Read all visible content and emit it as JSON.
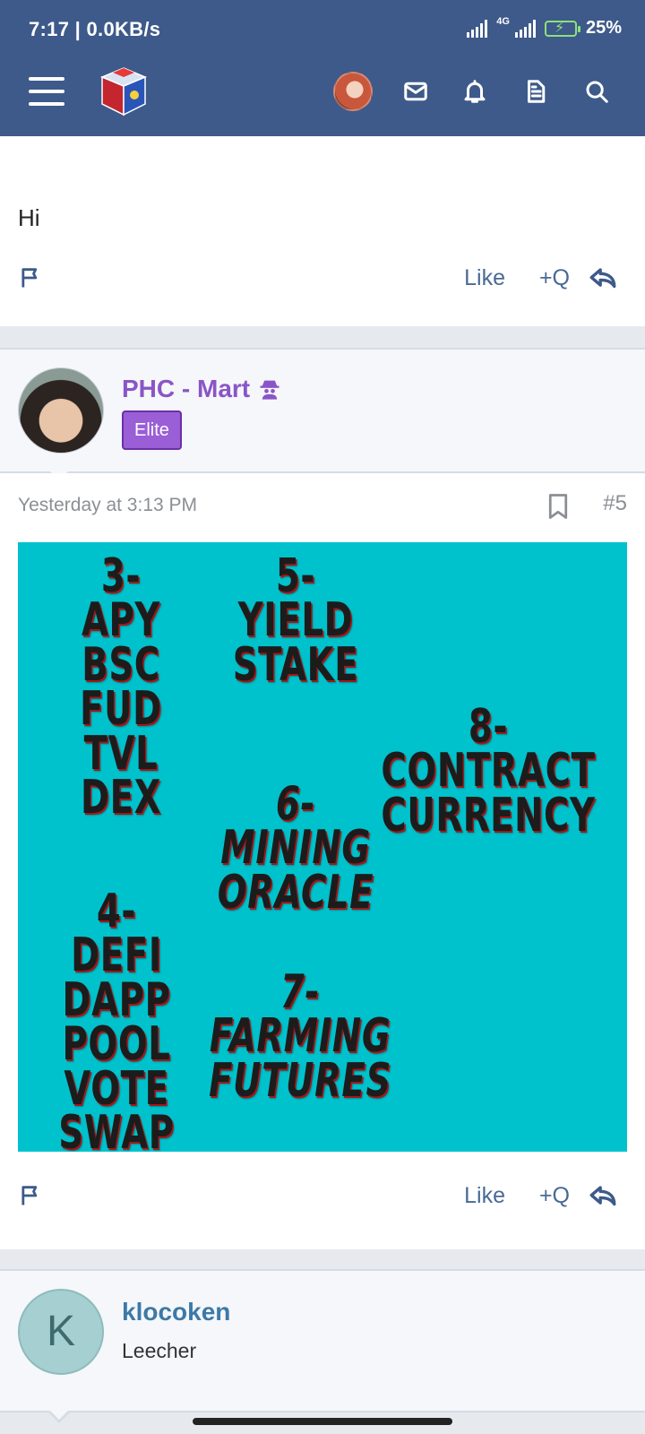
{
  "status_bar": {
    "time_speed": "7:17 | 0.0KB/s",
    "network": "4G",
    "battery": "25%"
  },
  "header": {
    "icons": [
      "menu-icon",
      "site-logo",
      "user-avatar",
      "mail-icon",
      "bell-icon",
      "document-icon",
      "search-icon"
    ],
    "bg_color": "#3d5a8a"
  },
  "post_prev": {
    "text": "Hi",
    "actions": {
      "like": "Like",
      "quote": "+Q"
    }
  },
  "post5": {
    "user": {
      "name": "PHC - Mart",
      "badge": "Elite",
      "name_color": "#8a55c7"
    },
    "time": "Yesterday at 3:13 PM",
    "number": "#5",
    "image_groups": [
      {
        "lines": [
          "3-",
          "APY",
          "BSC",
          "FUD",
          "TVL",
          "DEX"
        ]
      },
      {
        "lines": [
          "5-",
          "YIELD",
          "STAKE"
        ]
      },
      {
        "lines": [
          "8-",
          "CONTRACT",
          "CURRENCY"
        ]
      },
      {
        "lines": [
          "6-",
          "MINING",
          "ORACLE"
        ]
      },
      {
        "lines": [
          "4-",
          "DEFI",
          "DAPP",
          "POOL",
          "VOTE",
          "SWAP"
        ]
      },
      {
        "lines": [
          "7-",
          "FARMING",
          "FUTURES"
        ]
      }
    ],
    "actions": {
      "like": "Like",
      "quote": "+Q"
    }
  },
  "post6": {
    "user": {
      "initial": "K",
      "name": "klocoken",
      "role": "Leecher"
    }
  }
}
